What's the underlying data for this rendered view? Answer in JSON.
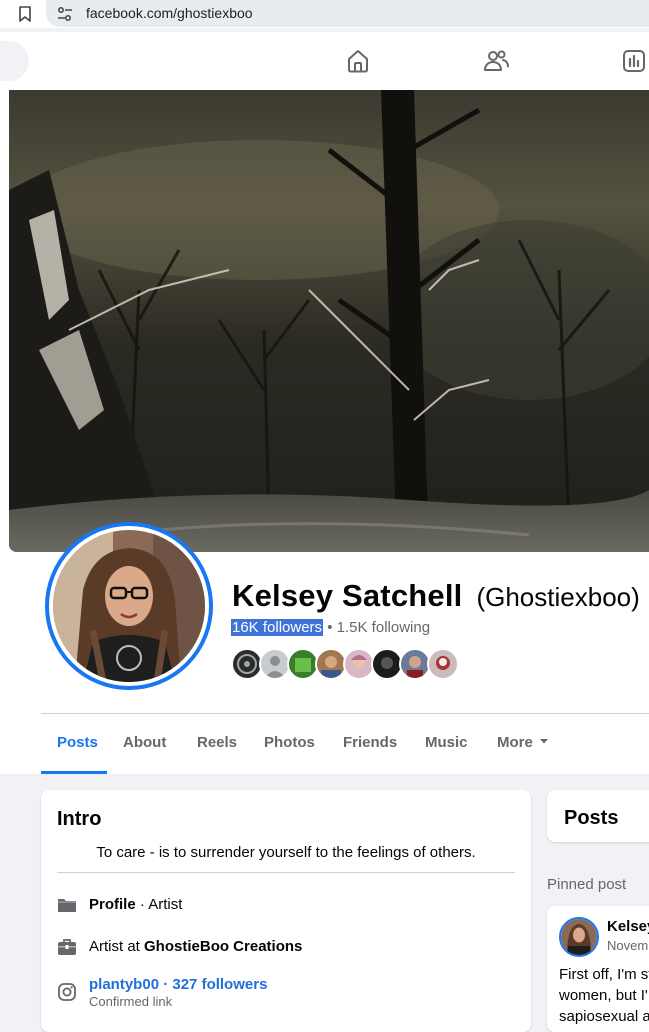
{
  "browser": {
    "url": "facebook.com/ghostiexboo"
  },
  "profile": {
    "name": "Kelsey Satchell",
    "alternate_name": "(Ghostiexboo)",
    "followers": "16K followers",
    "separator": "•",
    "following": "1.5K following",
    "mutual_friend_count_shown": 8
  },
  "tabs": [
    {
      "label": "Posts",
      "active": true
    },
    {
      "label": "About",
      "active": false
    },
    {
      "label": "Reels",
      "active": false
    },
    {
      "label": "Photos",
      "active": false
    },
    {
      "label": "Friends",
      "active": false
    },
    {
      "label": "Music",
      "active": false
    },
    {
      "label": "More",
      "active": false
    }
  ],
  "intro": {
    "title": "Intro",
    "bio": "To care - is to surrender yourself to the feelings of others.",
    "profile_label": "Profile",
    "profile_sep": " · ",
    "profile_category": "Artist",
    "work_prefix": "Artist at ",
    "work_company": "GhostieBoo Creations",
    "instagram_handle": "plantyb0",
    "instagram_followers": "327 followers",
    "instagram_sep": "0 · ",
    "instagram_confirmed": "Confirmed link"
  },
  "right_column": {
    "posts_title": "Posts",
    "pinned_label": "Pinned post",
    "post_author": "Kelsey",
    "post_date": "Novem",
    "post_lines": [
      "First off, I'm st",
      "women, but I'",
      "sapiosexual a"
    ]
  },
  "colors": {
    "accent": "#1877f2",
    "selection": "#3f73d8",
    "muted_text": "#65676b",
    "page_bg": "#f0f2f5"
  }
}
